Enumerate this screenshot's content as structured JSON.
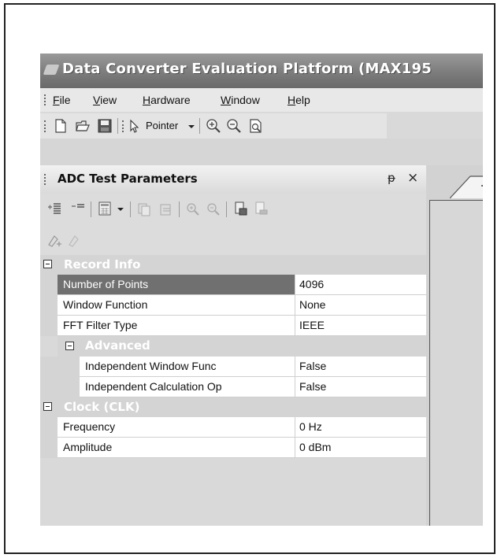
{
  "window": {
    "title": "Data Converter Evaluation Platform (MAX195"
  },
  "menu": [
    {
      "label": "File",
      "underline": "F",
      "rest": "ile"
    },
    {
      "label": "View",
      "underline": "V",
      "rest": "iew"
    },
    {
      "label": "Hardware",
      "underline": "H",
      "rest": "ardware"
    },
    {
      "label": "Window",
      "underline": "W",
      "rest": "indow"
    },
    {
      "label": "Help",
      "underline": "H",
      "rest": "elp"
    }
  ],
  "toolbar": {
    "pointer_label": "Pointer",
    "icons": [
      "new-file-icon",
      "open-folder-icon",
      "save-icon",
      "pointer-icon",
      "zoom-in-icon",
      "zoom-out-icon",
      "zoom-fit-icon"
    ]
  },
  "panel": {
    "title": "ADC Test Parameters",
    "pin_glyph": "ᵽ",
    "close_glyph": "×"
  },
  "grid": {
    "record_info": "Record Info",
    "number_of_points": {
      "name": "Number of Points",
      "value": "4096"
    },
    "window_function": {
      "name": "Window Function",
      "value": "None"
    },
    "fft_filter_type": {
      "name": "FFT Filter Type",
      "value": "IEEE"
    },
    "advanced": "Advanced",
    "independent_window": {
      "name": "Independent Window Func",
      "value": "False"
    },
    "independent_calc": {
      "name": "Independent Calculation Op",
      "value": "False"
    },
    "clock": "Clock (CLK)",
    "frequency": {
      "name": "Frequency",
      "value": "0 Hz"
    },
    "amplitude": {
      "name": "Amplitude",
      "value": "0 dBm"
    }
  }
}
